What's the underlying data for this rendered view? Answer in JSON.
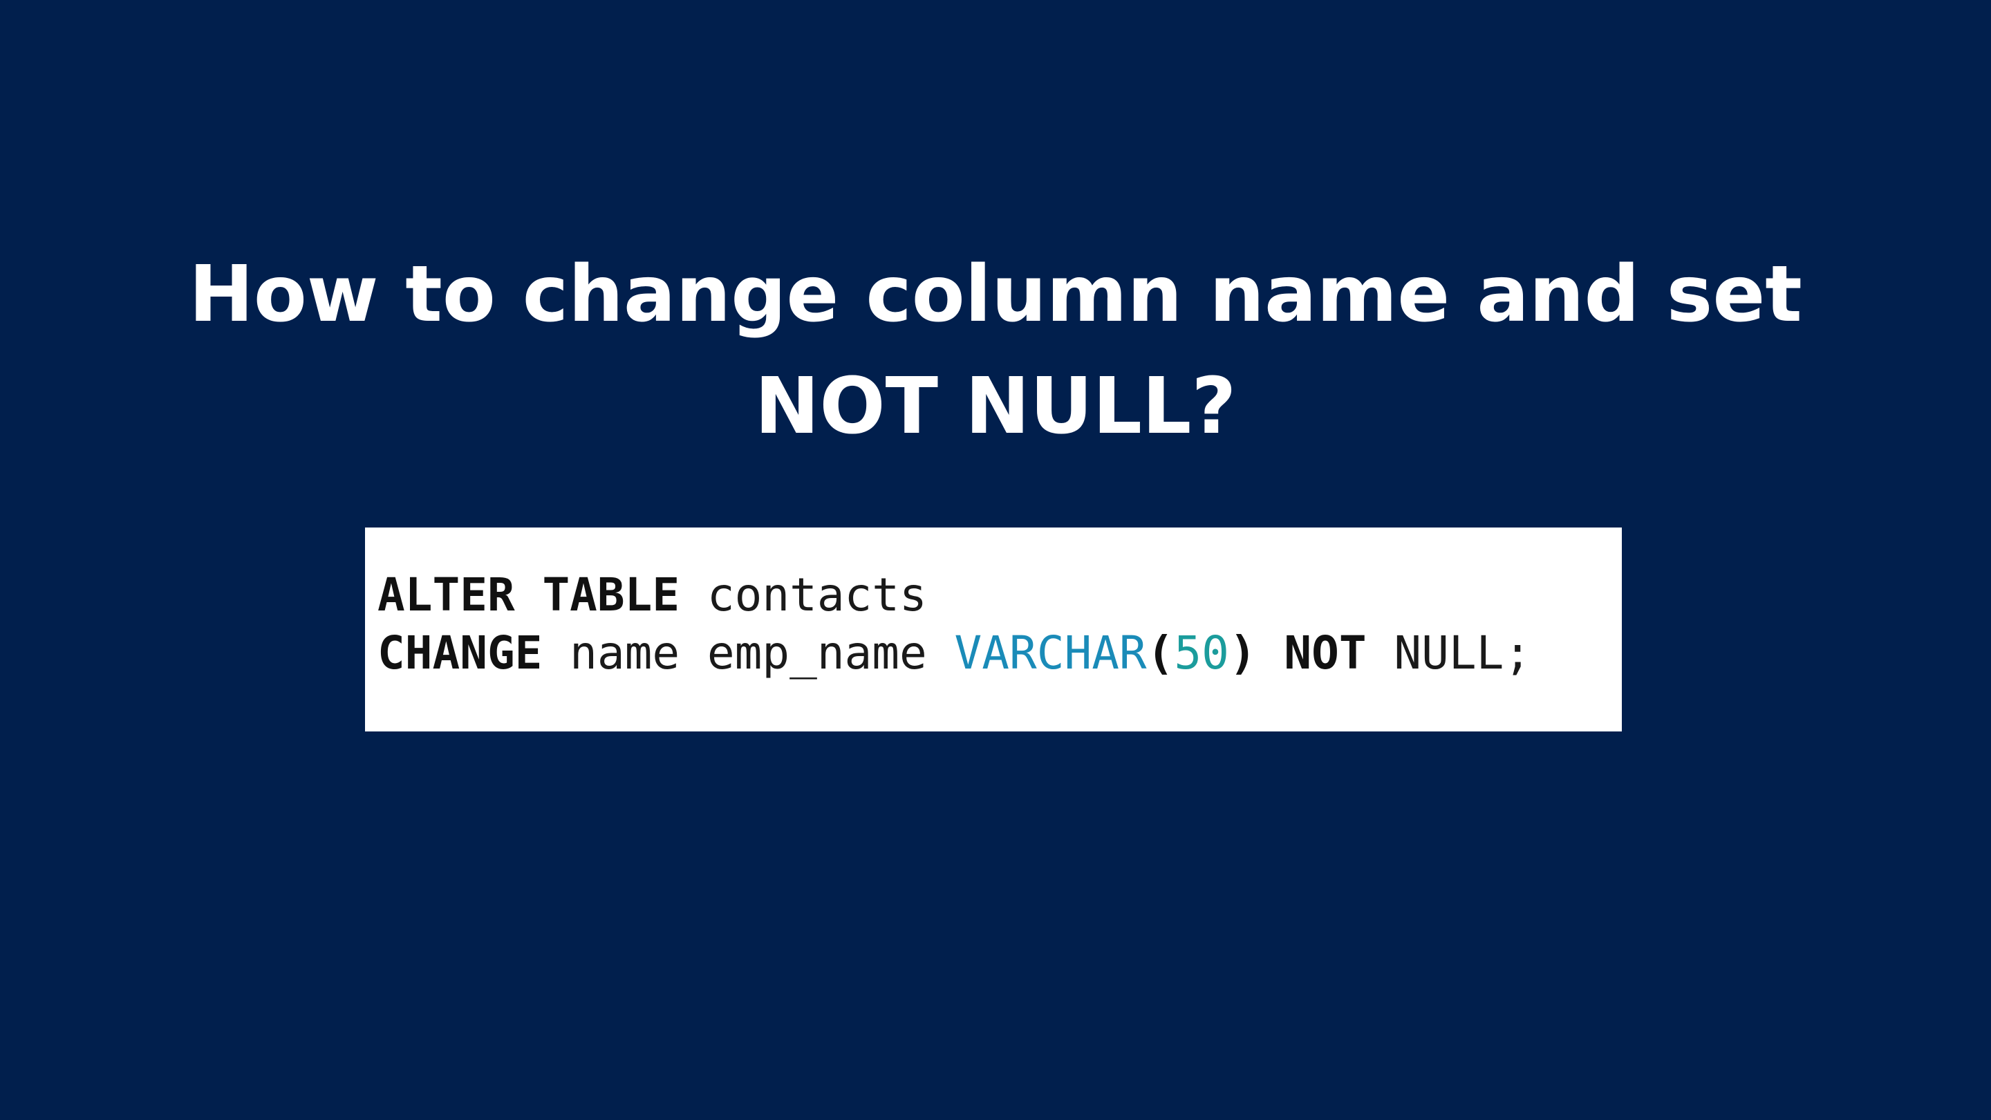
{
  "colors": {
    "background": "#011f4d",
    "title_text": "#ffffff",
    "code_background": "#ffffff",
    "code_keyword": "#111111",
    "code_type": "#1a8bb8",
    "code_number": "#1b9c9c"
  },
  "title": "How to change column name and set NOT NULL?",
  "code": {
    "line1": {
      "kw_alter": "ALTER",
      "kw_table": "TABLE",
      "table_name": "contacts"
    },
    "line2": {
      "kw_change": "CHANGE",
      "old_name": "name",
      "new_name": "emp_name",
      "type": "VARCHAR",
      "paren_open": "(",
      "length": "50",
      "paren_close": ")",
      "kw_not": "NOT",
      "null_end": "NULL;"
    }
  }
}
